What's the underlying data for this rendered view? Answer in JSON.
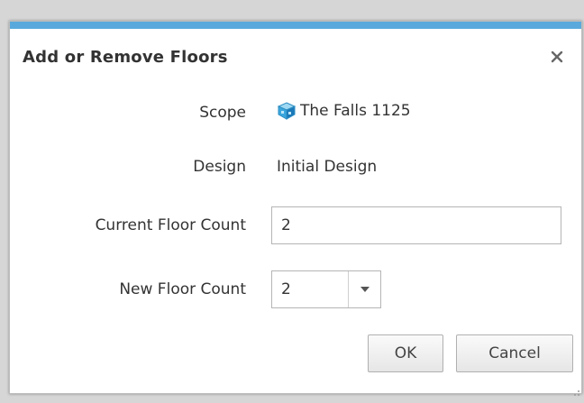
{
  "dialog": {
    "title": "Add or Remove Floors",
    "accent_color": "#5aa9dc",
    "close_icon": "close-icon"
  },
  "form": {
    "scope": {
      "label": "Scope",
      "value": "The Falls 1125",
      "icon": "building-cube-icon"
    },
    "design": {
      "label": "Design",
      "value": "Initial Design"
    },
    "current_floor_count": {
      "label": "Current Floor Count",
      "value": "2"
    },
    "new_floor_count": {
      "label": "New Floor Count",
      "selected": "2"
    }
  },
  "buttons": {
    "ok": "OK",
    "cancel": "Cancel"
  }
}
